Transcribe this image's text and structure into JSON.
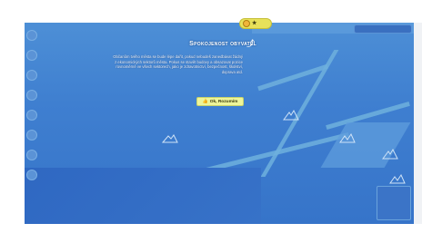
{
  "dialog": {
    "title": "Spokojenost obyvatel",
    "body": "Občanům tvého města se bude lépe dařit, pokud nebudeš zanedbávat žádný z ekonomických sektorů města. Pokus se stavět budovy a obsazovat pozice rovnoměrně ve všech sektorech, jako je zdravotnictví, bezpečnost, školství, doprava atd.",
    "ok_label": "Ok, Rozumím"
  },
  "icons": {
    "title_icon": "leaf-icon",
    "ok_icon": "thumbs-up-icon",
    "badge_icon": "coin-icon"
  },
  "colors": {
    "overlay": "#3f7fd0",
    "button": "#eef59a",
    "badge": "#e7e15a"
  }
}
